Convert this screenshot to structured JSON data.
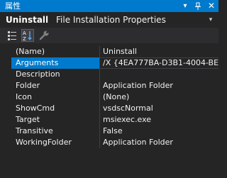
{
  "window": {
    "title": "属性",
    "dropdown_glyph": "▾",
    "pin_glyph": "ꟷ",
    "close_glyph": "✕"
  },
  "object": {
    "name": "Uninstall",
    "type": "File Installation Properties",
    "dropdown_glyph": "▾"
  },
  "toolbar": {
    "buttons": [
      "categorized-icon",
      "alphabetical-icon",
      "property-pages-icon"
    ]
  },
  "properties": [
    {
      "name": "(Name)",
      "value": "Uninstall"
    },
    {
      "name": "Arguments",
      "value": "/X {4EA777BA-D3B1-4004-BE"
    },
    {
      "name": "Description",
      "value": ""
    },
    {
      "name": "Folder",
      "value": "Application Folder"
    },
    {
      "name": "Icon",
      "value": "(None)"
    },
    {
      "name": "ShowCmd",
      "value": "vsdscNormal"
    },
    {
      "name": "Target",
      "value": "msiexec.exe"
    },
    {
      "name": "Transitive",
      "value": "False"
    },
    {
      "name": "WorkingFolder",
      "value": "Application Folder"
    }
  ],
  "colors": {
    "accent": "#007acc",
    "background": "#252526",
    "toolbar": "#2d2d30",
    "text": "#f1f1f1"
  }
}
